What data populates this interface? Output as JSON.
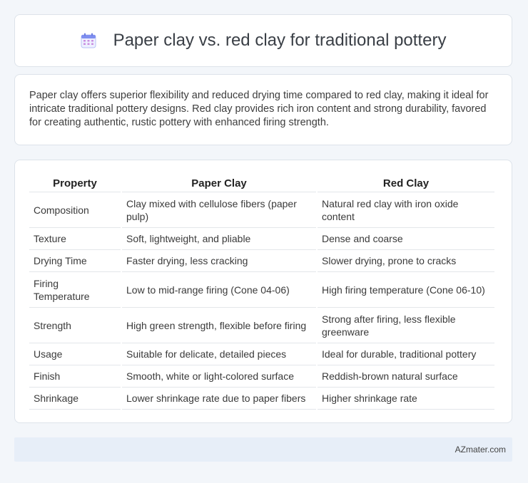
{
  "header": {
    "icon": "calendar-icon",
    "title": "Paper clay vs. red clay for traditional pottery"
  },
  "summary": "Paper clay offers superior flexibility and reduced drying time compared to red clay, making it ideal for intricate traditional pottery designs. Red clay provides rich iron content and strong durability, favored for creating authentic, rustic pottery with enhanced firing strength.",
  "table": {
    "headers": [
      "Property",
      "Paper Clay",
      "Red Clay"
    ],
    "rows": [
      [
        "Composition",
        "Clay mixed with cellulose fibers (paper pulp)",
        "Natural red clay with iron oxide content"
      ],
      [
        "Texture",
        "Soft, lightweight, and pliable",
        "Dense and coarse"
      ],
      [
        "Drying Time",
        "Faster drying, less cracking",
        "Slower drying, prone to cracks"
      ],
      [
        "Firing Temperature",
        "Low to mid-range firing (Cone 04-06)",
        "High firing temperature (Cone 06-10)"
      ],
      [
        "Strength",
        "High green strength, flexible before firing",
        "Strong after firing, less flexible greenware"
      ],
      [
        "Usage",
        "Suitable for delicate, detailed pieces",
        "Ideal for durable, traditional pottery"
      ],
      [
        "Finish",
        "Smooth, white or light-colored surface",
        "Reddish-brown natural surface"
      ],
      [
        "Shrinkage",
        "Lower shrinkage rate due to paper fibers",
        "Higher shrinkage rate"
      ]
    ]
  },
  "footer": {
    "brand": "AZmater.com"
  }
}
